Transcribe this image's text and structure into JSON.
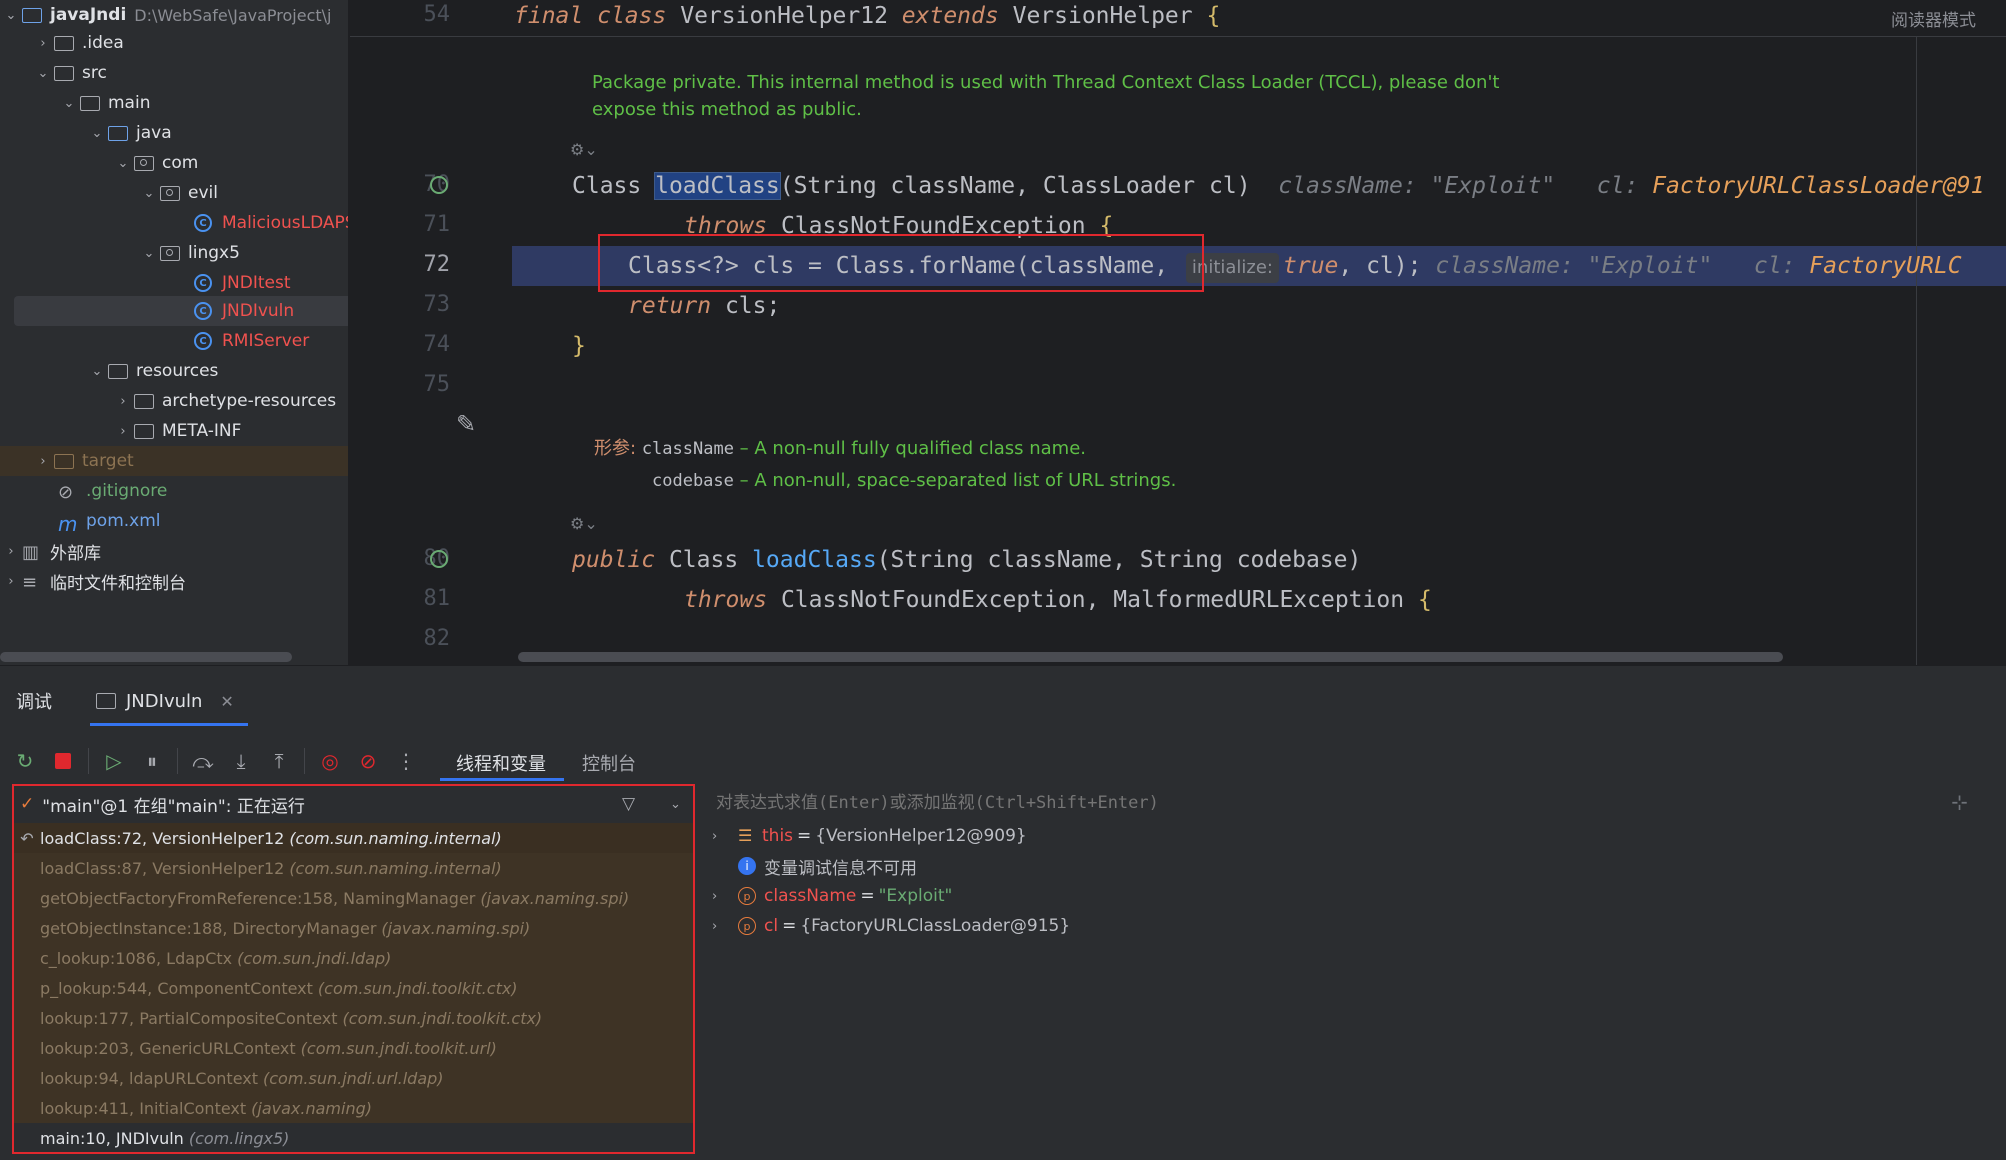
{
  "project_tree": [
    {
      "label": "javaJndi",
      "path": "D:\\WebSafe\\JavaProject\\j",
      "depth": 0,
      "expanded": true,
      "kind": "module"
    },
    {
      "label": ".idea",
      "depth": 1,
      "expanded": false,
      "kind": "folder"
    },
    {
      "label": "src",
      "depth": 1,
      "expanded": true,
      "kind": "folder"
    },
    {
      "label": "main",
      "depth": 2,
      "expanded": true,
      "kind": "folder"
    },
    {
      "label": "java",
      "depth": 3,
      "expanded": true,
      "kind": "src-folder"
    },
    {
      "label": "com",
      "depth": 4,
      "expanded": true,
      "kind": "package"
    },
    {
      "label": "evil",
      "depth": 5,
      "expanded": true,
      "kind": "package"
    },
    {
      "label": "MaliciousLDAPS",
      "depth": 6,
      "kind": "class"
    },
    {
      "label": "lingx5",
      "depth": 5,
      "expanded": true,
      "kind": "package"
    },
    {
      "label": "JNDItest",
      "depth": 6,
      "kind": "class"
    },
    {
      "label": "JNDIvuln",
      "depth": 6,
      "kind": "class",
      "selected": true
    },
    {
      "label": "RMIServer",
      "depth": 6,
      "kind": "class"
    },
    {
      "label": "resources",
      "depth": 3,
      "expanded": true,
      "kind": "folder"
    },
    {
      "label": "archetype-resources",
      "depth": 4,
      "expanded": false,
      "kind": "folder"
    },
    {
      "label": "META-INF",
      "depth": 4,
      "expanded": false,
      "kind": "folder"
    },
    {
      "label": "target",
      "depth": 1,
      "expanded": false,
      "kind": "excluded"
    },
    {
      "label": ".gitignore",
      "depth": 1,
      "kind": "ignore"
    },
    {
      "label": "pom.xml",
      "depth": 1,
      "kind": "maven"
    },
    {
      "label": "外部库",
      "depth": 0,
      "expanded": false,
      "kind": "library"
    },
    {
      "label": "临时文件和控制台",
      "depth": 0,
      "expanded": false,
      "kind": "scratch"
    }
  ],
  "editor": {
    "reader_mode": "阅读器模式",
    "line_numbers": {
      "l54": "54",
      "l70": "70",
      "l71": "71",
      "l72": "72",
      "l73": "73",
      "l74": "74",
      "l75": "75",
      "l80": "80",
      "l81": "81",
      "l82": "82"
    },
    "header_line": {
      "kw_final": "final",
      "kw_class": "class",
      "name": "VersionHelper12",
      "kw_extends": "extends",
      "parent": "VersionHelper",
      "brace": "{"
    },
    "doc1_line1": "Package private. This internal method is used with Thread Context Class Loader (TCCL), please don't",
    "doc1_line2": "expose this method as public.",
    "l70": {
      "type": "Class",
      "method": "loadClass",
      "params": "(String className, ClassLoader cl)",
      "hint1": "className: \"Exploit\"",
      "hint2_label": "cl:",
      "hint2_val": "FactoryURLClassLoader@91"
    },
    "l71": {
      "kw": "throws",
      "exc": "ClassNotFoundException",
      "brace": "{"
    },
    "l72": {
      "code1": "Class<?> cls = Class.forName(className,",
      "param_hint": "initialize:",
      "kw_true": "true",
      "code2": ", cl);",
      "hint1": "className: \"Exploit\"",
      "hint2_label": "cl:",
      "hint2_val": "FactoryURLC"
    },
    "l73": {
      "kw": "return",
      "code": " cls;"
    },
    "l74": {
      "brace": "}"
    },
    "doc2": {
      "label": "形参:",
      "p1_name": "className",
      "p1_desc": "– A non-null fully qualified class name.",
      "p2_name": "codebase",
      "p2_desc": "– A non-null, space-separated list of URL strings."
    },
    "l80": {
      "kw": "public",
      "type": "Class",
      "method": "loadClass",
      "params": "(String className, String codebase)"
    },
    "l81": {
      "kw": "throws",
      "exc": "ClassNotFoundException, MalformedURLException",
      "brace": "{"
    }
  },
  "debug": {
    "title": "调试",
    "tab_label": "JNDIvuln",
    "subtabs": {
      "threads": "线程和变量",
      "console": "控制台"
    },
    "thread": "\"main\"@1 在组\"main\": 正在运行",
    "frames": [
      {
        "method": "loadClass:72, VersionHelper12",
        "pkg": "(com.sun.naming.internal)"
      },
      {
        "method": "loadClass:87, VersionHelper12",
        "pkg": "(com.sun.naming.internal)"
      },
      {
        "method": "getObjectFactoryFromReference:158, NamingManager",
        "pkg": "(javax.naming.spi)"
      },
      {
        "method": "getObjectInstance:188, DirectoryManager",
        "pkg": "(javax.naming.spi)"
      },
      {
        "method": "c_lookup:1086, LdapCtx",
        "pkg": "(com.sun.jndi.ldap)"
      },
      {
        "method": "p_lookup:544, ComponentContext",
        "pkg": "(com.sun.jndi.toolkit.ctx)"
      },
      {
        "method": "lookup:177, PartialCompositeContext",
        "pkg": "(com.sun.jndi.toolkit.ctx)"
      },
      {
        "method": "lookup:203, GenericURLContext",
        "pkg": "(com.sun.jndi.toolkit.url)"
      },
      {
        "method": "lookup:94, ldapURLContext",
        "pkg": "(com.sun.jndi.url.ldap)"
      },
      {
        "method": "lookup:411, InitialContext",
        "pkg": "(javax.naming)"
      },
      {
        "method": "main:10, JNDIvuln",
        "pkg": "(com.lingx5)"
      }
    ],
    "eval_placeholder": "对表达式求值(Enter)或添加监视(Ctrl+Shift+Enter)",
    "variables": [
      {
        "name": "this",
        "eq": "=",
        "value": "{VersionHelper12@909}",
        "icon": "list-icon",
        "expandable": true
      },
      {
        "info": "变量调试信息不可用",
        "icon": "info-icon",
        "expandable": false
      },
      {
        "name": "className",
        "eq": "=",
        "value": "\"Exploit\"",
        "icon": "param-icon",
        "expandable": true
      },
      {
        "name": "cl",
        "eq": "=",
        "value": "{FactoryURLClassLoader@915}",
        "icon": "param-icon",
        "expandable": true
      }
    ]
  }
}
